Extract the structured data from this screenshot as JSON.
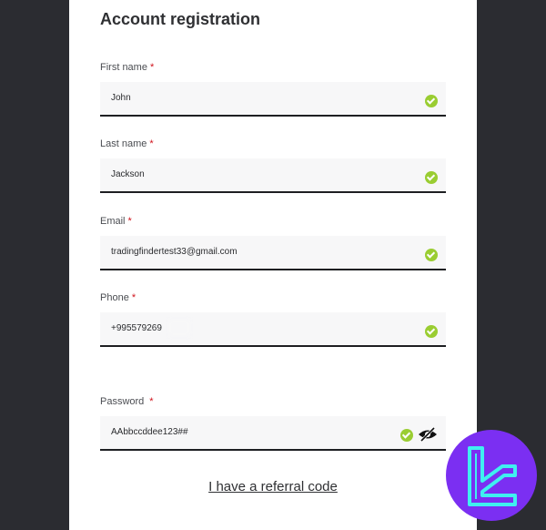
{
  "form": {
    "title": "Account registration",
    "fields": [
      {
        "label": "First name",
        "required": "*",
        "value": "John",
        "valid": true
      },
      {
        "label": "Last name",
        "required": "*",
        "value": "Jackson",
        "valid": true
      },
      {
        "label": "Email",
        "required": "*",
        "value": "tradingfindertest33@gmail.com",
        "valid": true
      },
      {
        "label": "Phone",
        "required": "*",
        "value": "+995579269",
        "valid": true
      },
      {
        "label": "Password",
        "required": "*",
        "value": "AAbbccddee123##",
        "valid": true
      }
    ],
    "referral_link": "I have a referral code"
  },
  "icons": {
    "valid": "check-circle-icon",
    "password_toggle": "eye-slash-icon",
    "watermark": "tradingfinder-logo"
  },
  "colors": {
    "background": "#2b2c31",
    "panel": "#ffffff",
    "valid_check": "#9acd32",
    "required_mark": "#d0121b",
    "badge": "#7b2ff2",
    "badge_logo": "#3ff0f0"
  }
}
